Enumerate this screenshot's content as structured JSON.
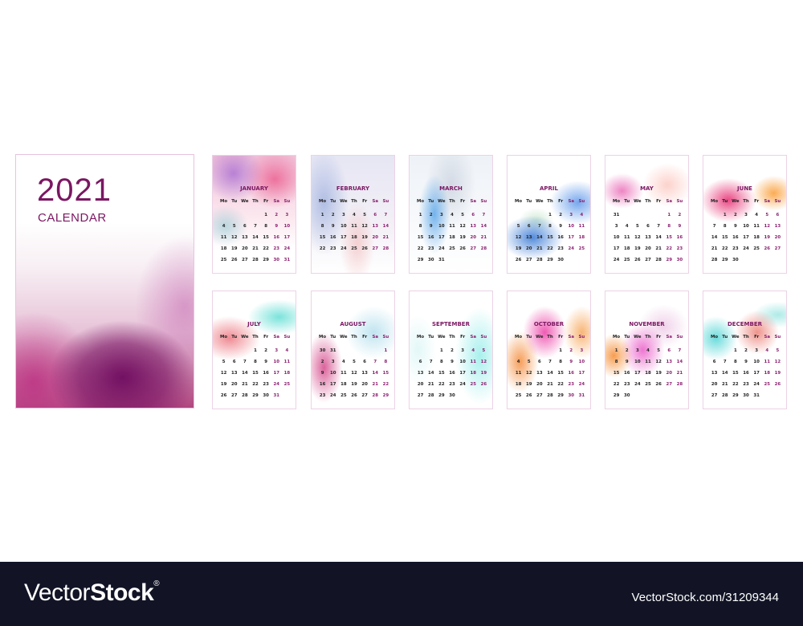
{
  "cover": {
    "year": "2021",
    "label": "CALENDAR"
  },
  "weekdays": [
    "Mo",
    "Tu",
    "We",
    "Th",
    "Fr",
    "Sa",
    "Su"
  ],
  "months": [
    {
      "name": "JANUARY",
      "offset": 4,
      "days": 31,
      "lead": []
    },
    {
      "name": "FEBRUARY",
      "offset": 0,
      "days": 28,
      "lead": []
    },
    {
      "name": "MARCH",
      "offset": 0,
      "days": 31,
      "lead": []
    },
    {
      "name": "APRIL",
      "offset": 3,
      "days": 30,
      "lead": []
    },
    {
      "name": "MAY",
      "offset": 5,
      "days": 30,
      "lead": [
        "31"
      ]
    },
    {
      "name": "JUNE",
      "offset": 1,
      "days": 30,
      "lead": []
    },
    {
      "name": "JULY",
      "offset": 3,
      "days": 31,
      "lead": []
    },
    {
      "name": "AUGUST",
      "offset": 6,
      "days": 29,
      "lead": [
        "30",
        "31"
      ]
    },
    {
      "name": "SEPTEMBER",
      "offset": 2,
      "days": 30,
      "lead": []
    },
    {
      "name": "OCTOBER",
      "offset": 4,
      "days": 31,
      "lead": []
    },
    {
      "name": "NOVEMBER",
      "offset": 0,
      "days": 30,
      "lead": []
    },
    {
      "name": "DECEMBER",
      "offset": 2,
      "days": 31,
      "lead": []
    }
  ],
  "footer": {
    "brand_light": "Vector",
    "brand_bold": "Stock",
    "registered": "®",
    "reference": "VectorStock.com/31209344"
  },
  "colors": {
    "accent": "#7a1762",
    "weekend": "#8a1f6f",
    "footer_bg": "#121426"
  }
}
